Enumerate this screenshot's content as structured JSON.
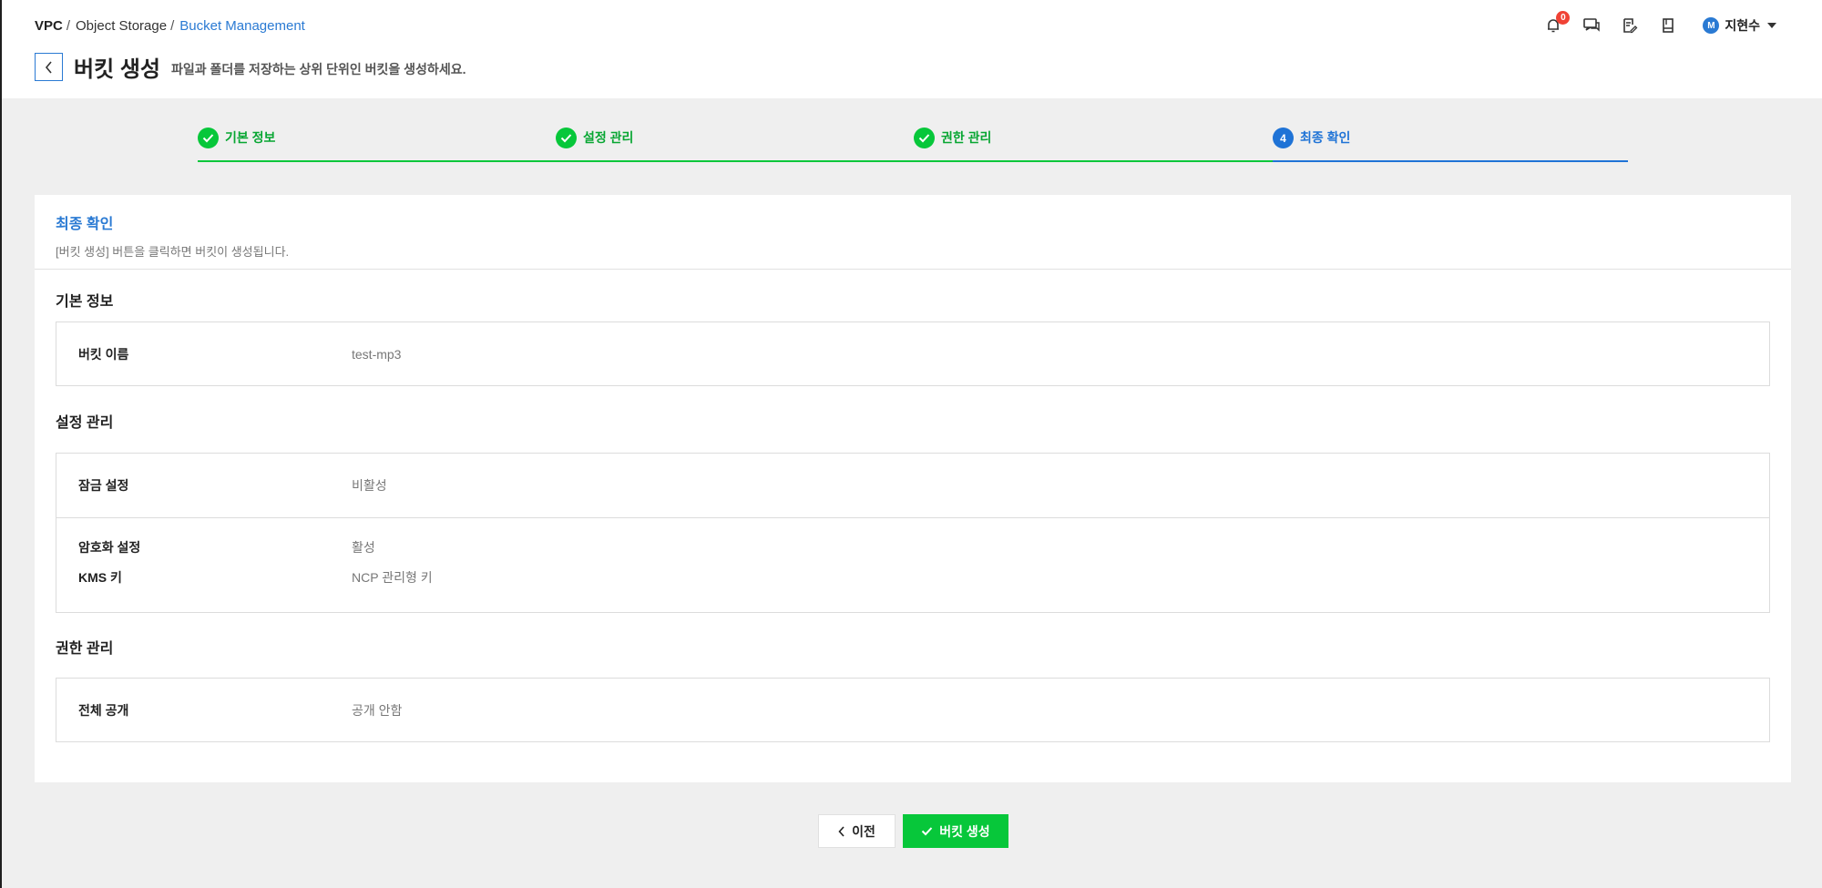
{
  "breadcrumb": {
    "vpc": "VPC",
    "object_storage": "Object Storage",
    "bucket_management": "Bucket Management",
    "separator": "/"
  },
  "header": {
    "title": "버킷 생성",
    "subtitle": "파일과 폴더를 저장하는 상위 단위인 버킷을 생성하세요.",
    "notification_count": "0",
    "user_initial": "M",
    "user_name": "지현수"
  },
  "steps": [
    {
      "label": "기본 정보",
      "state": "done"
    },
    {
      "label": "설정 관리",
      "state": "done"
    },
    {
      "label": "권한 관리",
      "state": "done"
    },
    {
      "label": "최종 확인",
      "state": "current",
      "number": "4"
    }
  ],
  "card": {
    "title": "최종 확인",
    "description": "[버킷 생성] 버튼을 클릭하면 버킷이 생성됩니다."
  },
  "sections": {
    "basic": {
      "title": "기본 정보",
      "rows": [
        {
          "label": "버킷 이름",
          "value": "test-mp3"
        }
      ]
    },
    "settings": {
      "title": "설정 관리",
      "lock": {
        "label": "잠금 설정",
        "value": "비활성"
      },
      "encryption": {
        "label": "암호화 설정",
        "value": "활성"
      },
      "kms": {
        "label": "KMS 키",
        "value": "NCP 관리형 키"
      }
    },
    "permissions": {
      "title": "권한 관리",
      "rows": [
        {
          "label": "전체 공개",
          "value": "공개 안함"
        }
      ]
    }
  },
  "buttons": {
    "prev": "이전",
    "create": "버킷 생성"
  },
  "colors": {
    "accent_blue": "#2a7ad3",
    "success_green": "#07c73a",
    "badge_red": "#f04235"
  },
  "icons": [
    "chevron-left-icon",
    "bell-icon",
    "chat-icon",
    "edit-note-icon",
    "book-icon",
    "check-icon",
    "caret-down-icon"
  ]
}
